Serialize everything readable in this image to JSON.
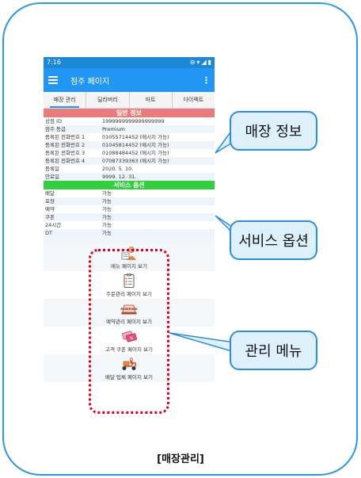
{
  "status_bar": {
    "time": "7:16"
  },
  "app_bar": {
    "title": "점주 페이지",
    "more": "⋮"
  },
  "tabs": [
    "매장 관리",
    "딜리버리",
    "마트",
    "다이렉트"
  ],
  "general_info": {
    "header": "일반 정보",
    "rows": [
      {
        "label": "상점 ID",
        "value": "1999999999999999999"
      },
      {
        "label": "점주 등급",
        "value": "Premium"
      },
      {
        "label": "등록된 전화번호 1",
        "value": "01055714452 (메시지 가능)"
      },
      {
        "label": "등록된 전화번호 2",
        "value": "01045814452 (메시지 가능)"
      },
      {
        "label": "등록된 전화번호 3",
        "value": "01088484452 (메시지 가능)"
      },
      {
        "label": "등록된 전화번호 4",
        "value": "07087339363 (메시지 가능)"
      },
      {
        "label": "등록일",
        "value": "2020. 5. 10."
      },
      {
        "label": "만료일",
        "value": "9999. 12. 31."
      }
    ]
  },
  "service_options": {
    "header": "서비스 옵션",
    "rows": [
      {
        "label": "배달",
        "value": "가능"
      },
      {
        "label": "포장",
        "value": "가능"
      },
      {
        "label": "예약",
        "value": "가능"
      },
      {
        "label": "쿠폰",
        "value": "가능"
      },
      {
        "label": "24시간",
        "value": "가능"
      },
      {
        "label": "DT",
        "value": "가능"
      }
    ]
  },
  "menu": [
    {
      "label": "메뉴 페이지 보기",
      "icon": "menu-icon"
    },
    {
      "label": "주문관리 페이지 보기",
      "icon": "order-icon"
    },
    {
      "label": "예약관리 페이지 보기",
      "icon": "reserved-icon"
    },
    {
      "label": "고객 쿠폰 페이지 보기",
      "icon": "coupon-icon"
    },
    {
      "label": "배달 업체 페이지 보기",
      "icon": "delivery-icon"
    }
  ],
  "reserved_sign": "RESERVED",
  "callouts": {
    "store_info": "매장 정보",
    "service_options": "서비스 옵션",
    "management_menu": "관리 메뉴"
  },
  "caption": "[매장관리]"
}
